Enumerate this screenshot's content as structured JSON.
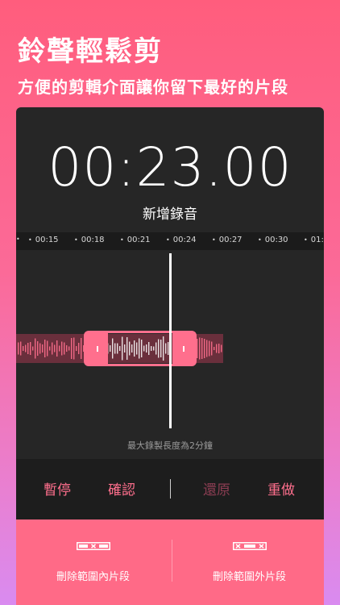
{
  "promo": {
    "title": "鈴聲輕鬆剪",
    "subtitle": "方便的剪輯介面讓你留下最好的片段"
  },
  "editor": {
    "timer": "00:23.00",
    "recording_name": "新增錄音",
    "ruler_ticks": [
      "00:15",
      "00:18",
      "00:21",
      "00:24",
      "00:27",
      "00:30",
      "01:"
    ],
    "max_length_note": "最大錄製長度為2分鐘"
  },
  "controls": {
    "pause": "暫停",
    "confirm": "確認",
    "restore": "還原",
    "redo": "重做"
  },
  "bottom_actions": {
    "delete_inside": "刪除範圍內片段",
    "delete_outside": "刪除範圍外片段"
  },
  "colors": {
    "accent": "#ff6f8d",
    "accent_disabled": "#8b3d52",
    "panel_bg": "#262626",
    "bottom_bar": "#ff6a87"
  }
}
